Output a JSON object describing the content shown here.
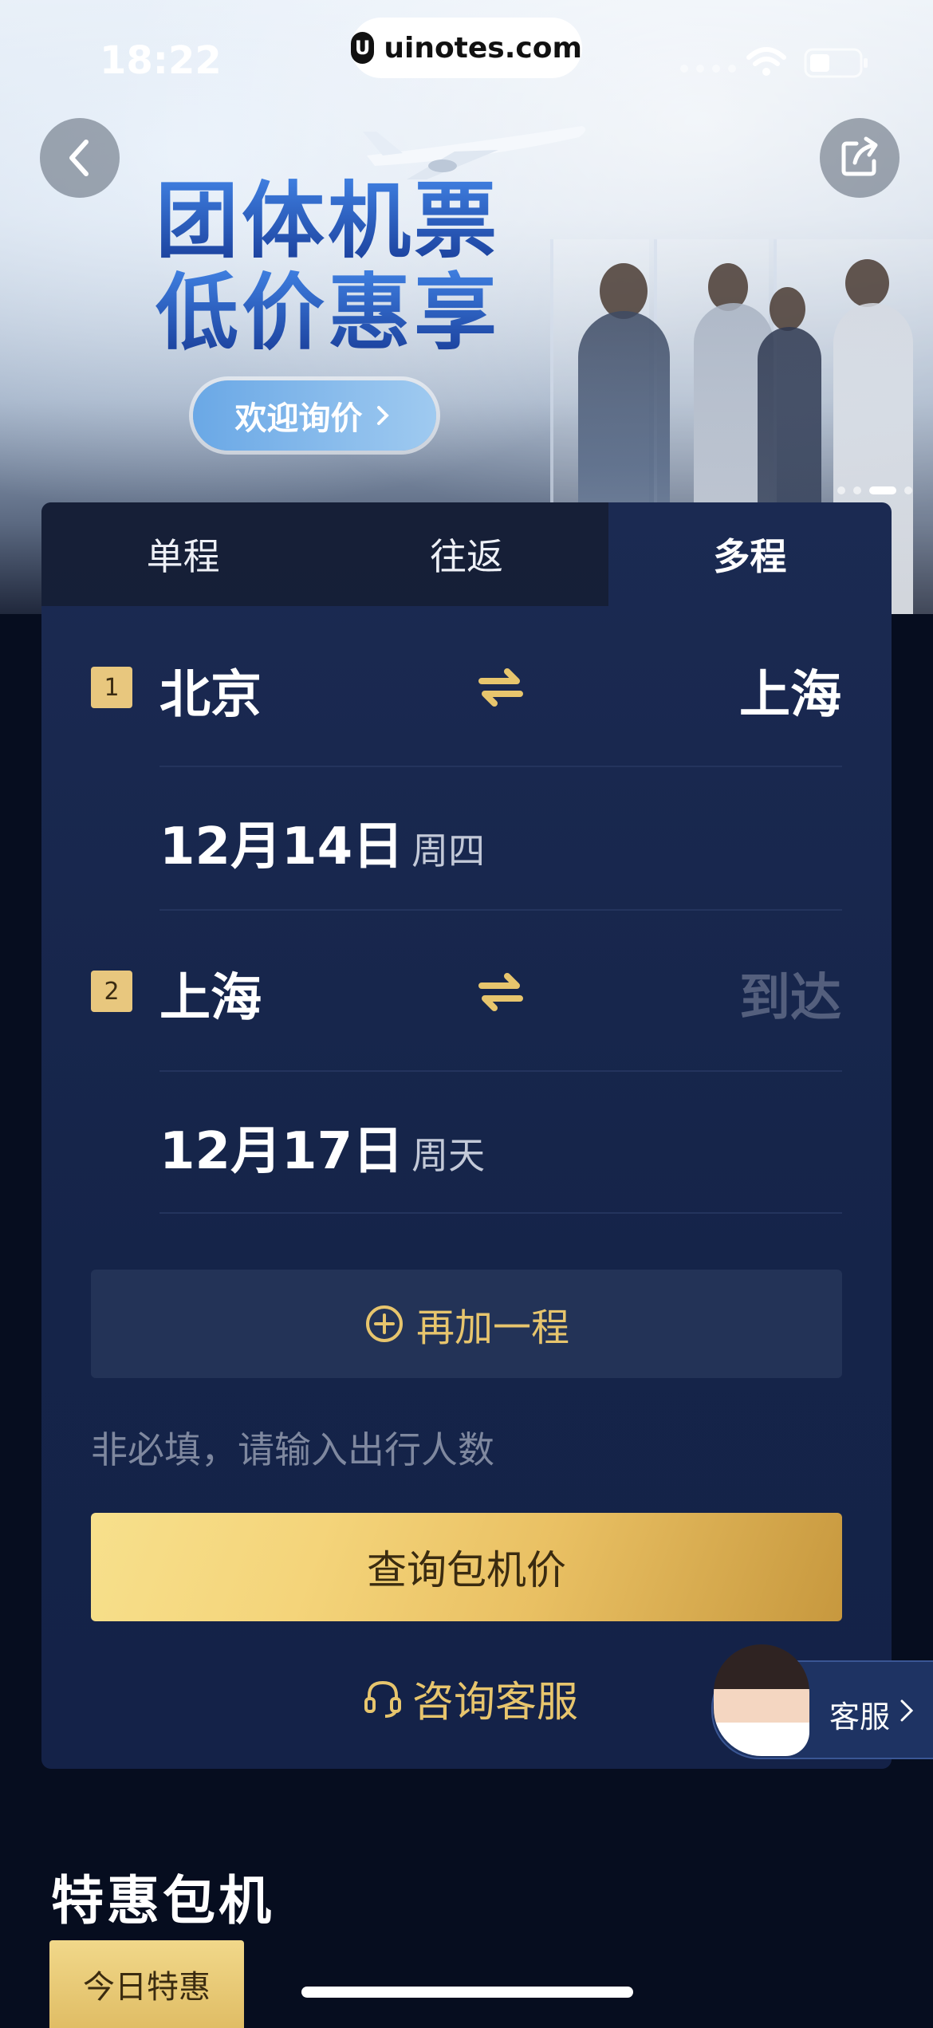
{
  "status_bar": {
    "time": "18:22"
  },
  "url_bar": {
    "domain": "uinotes.com"
  },
  "banner": {
    "title_line1": "团体机票",
    "title_line2": "低价惠享",
    "cta": "欢迎询价"
  },
  "tabs": [
    {
      "label": "单程",
      "active": false
    },
    {
      "label": "往返",
      "active": false
    },
    {
      "label": "多程",
      "active": true
    }
  ],
  "legs": [
    {
      "num": "1",
      "from": "北京",
      "to": "上海",
      "date": "12月14日",
      "weekday": "周四"
    },
    {
      "num": "2",
      "from": "上海",
      "to_placeholder": "到达",
      "date": "12月17日",
      "weekday": "周天"
    }
  ],
  "add_leg_label": "再加一程",
  "passengers_placeholder": "非必填，请输入出行人数",
  "query_button": "查询包机价",
  "consult_label": "咨询客服",
  "cs_float_label": "客服",
  "section_title": "特惠包机",
  "today_tag": "今日特惠",
  "colors": {
    "accent_gold": "#e7c56d",
    "card_bg": "#1b2a52",
    "page_bg": "#060d1f"
  }
}
